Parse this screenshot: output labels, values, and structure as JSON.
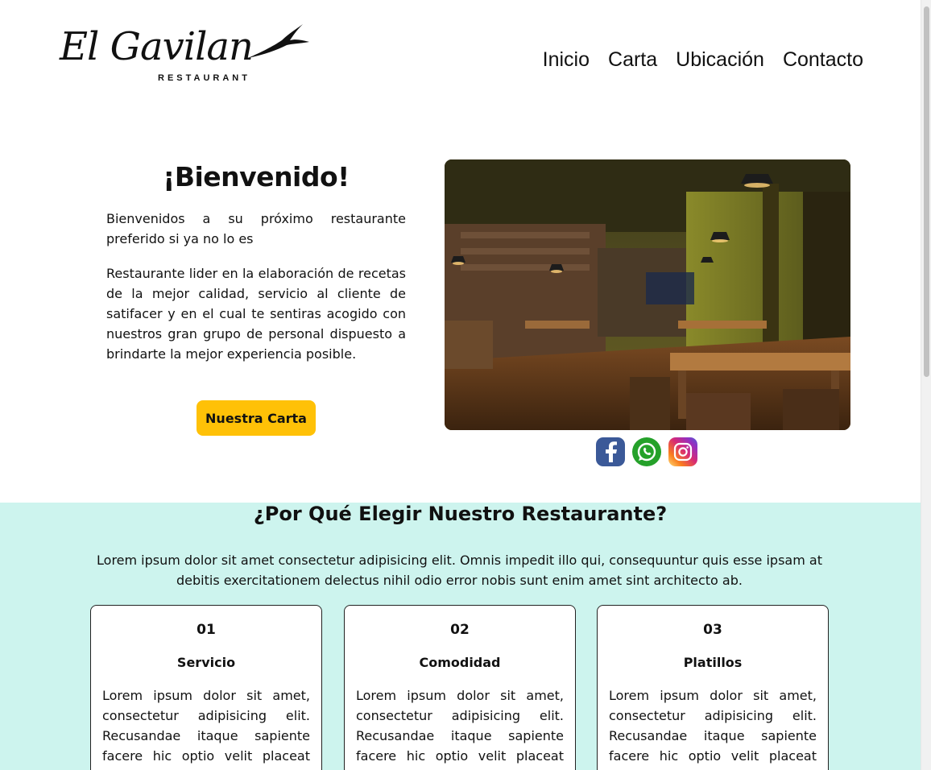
{
  "logo": {
    "script_text": "El Gavilan",
    "sub_text": "RESTAURANT"
  },
  "nav": {
    "items": [
      "Inicio",
      "Carta",
      "Ubicación",
      "Contacto"
    ]
  },
  "hero": {
    "title": "¡Bienvenido!",
    "paragraph_1": "Bienvenidos a su próximo restaurante preferido si ya no lo es",
    "paragraph_2": "Restaurante lider en la elaboración de recetas de la mejor calidad, servicio al cliente de satifacer y en el cual te sentiras acogido con nuestros gran grupo de personal dispuesto a brindarte la mejor experiencia posible.",
    "button_label": "Nuestra Carta"
  },
  "socials": {
    "icons": [
      "facebook-icon",
      "whatsapp-icon",
      "instagram-icon"
    ]
  },
  "why": {
    "title": "¿Por Qué Elegir Nuestro Restaurante?",
    "description": "Lorem ipsum dolor sit amet consectetur adipisicing elit. Omnis impedit illo qui, consequuntur quis esse ipsam at debitis exercitationem delectus nihil odio error nobis sunt enim amet sint architecto ab.",
    "cards": [
      {
        "number": "01",
        "title": "Servicio",
        "text": "Lorem ipsum dolor sit amet, consectetur adipisicing elit. Recusandae itaque sapiente facere hic optio velit placeat"
      },
      {
        "number": "02",
        "title": "Comodidad",
        "text": "Lorem ipsum dolor sit amet, consectetur adipisicing elit. Recusandae itaque sapiente facere hic optio velit placeat"
      },
      {
        "number": "03",
        "title": "Platillos",
        "text": "Lorem ipsum dolor sit amet, consectetur adipisicing elit. Recusandae itaque sapiente facere hic optio velit placeat"
      }
    ]
  },
  "colors": {
    "accent_button": "#ffc107",
    "section_background": "#cdf4ee",
    "text": "#111111"
  }
}
